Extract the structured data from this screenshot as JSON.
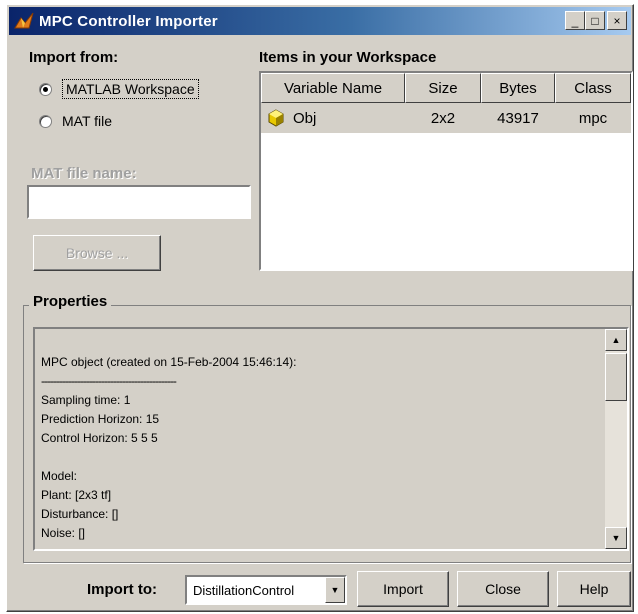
{
  "window": {
    "title": "MPC Controller Importer",
    "minimize_label": "_",
    "maximize_label": "□",
    "close_label": "×"
  },
  "import_from": {
    "label": "Import from:",
    "options": [
      {
        "label": "MATLAB Workspace",
        "selected": true
      },
      {
        "label": "MAT file",
        "selected": false
      }
    ]
  },
  "mat_file": {
    "label": "MAT file name:",
    "value": "",
    "browse_label": "Browse ..."
  },
  "workspace": {
    "label": "Items in your Workspace",
    "columns": [
      "Variable Name",
      "Size",
      "Bytes",
      "Class"
    ],
    "rows": [
      {
        "name": "Obj",
        "size": "2x2",
        "bytes": "43917",
        "class": "mpc"
      }
    ]
  },
  "properties": {
    "label": "Properties",
    "lines": [
      "MPC object (created on 15-Feb-2004 15:46:14):",
      "---------------------------------------------",
      "Sampling time: 1",
      "Prediction Horizon: 15",
      "Control Horizon: 5 5 5",
      "",
      "Model:",
      "Plant: [2x3 tf]",
      "Disturbance: []",
      "Noise: []"
    ]
  },
  "footer": {
    "import_to_label": "Import to:",
    "import_to_value": "DistillationControl",
    "import_button": "Import",
    "close_button": "Close",
    "help_button": "Help"
  },
  "icons": {
    "app": "simulink-icon",
    "object": "mpc-object-icon"
  }
}
